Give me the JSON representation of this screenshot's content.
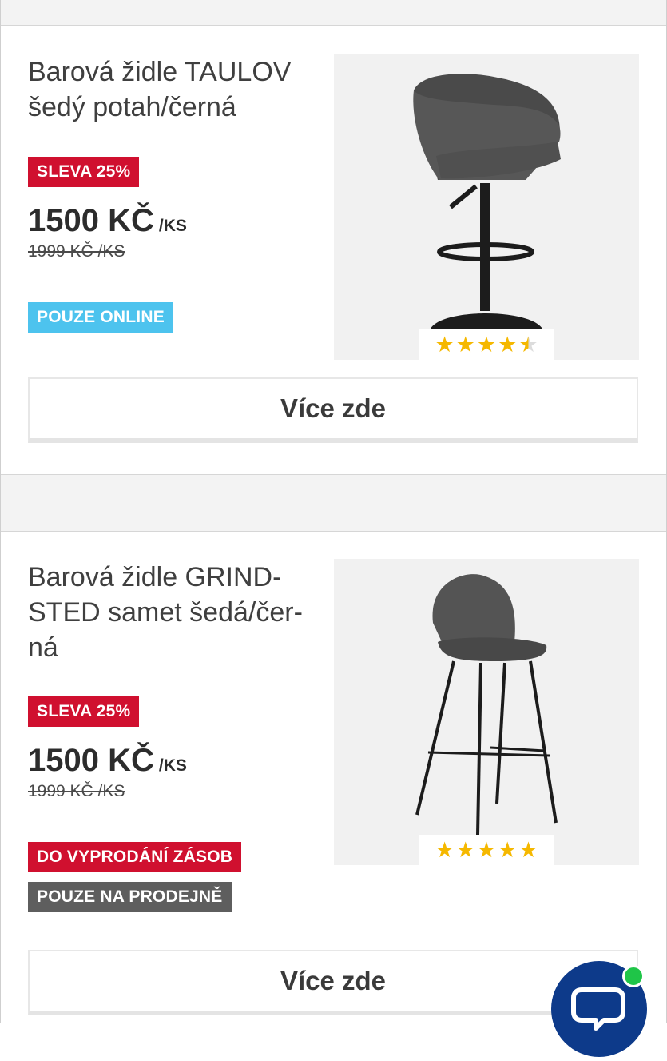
{
  "products": [
    {
      "title": "Barová židle TAULOV šedý potah/černá",
      "discount_badge": "SLEVA 25%",
      "price": "1500 KČ",
      "price_unit": "/KS",
      "old_price": "1999 KČ /KS",
      "tags": [
        "POUZE ONLINE"
      ],
      "rating": 4.5,
      "image": "bar-stool-taulov",
      "more_label": "Více zde"
    },
    {
      "title": "Barová židle GRIND-STED samet šedá/čer-ná",
      "title_lines": [
        "Barová židle GRIND-",
        "STED samet šedá/čer-",
        "ná"
      ],
      "discount_badge": "SLEVA 25%",
      "price": "1500 KČ",
      "price_unit": "/KS",
      "old_price": "1999 KČ /KS",
      "tags": [
        "DO VYPRODÁNÍ ZÁSOB",
        "POUZE NA PRODEJNĚ"
      ],
      "rating": 5,
      "image": "bar-stool-grindsted",
      "more_label": "Více zde"
    }
  ],
  "colors": {
    "sale_red": "#d0102f",
    "online_blue": "#4dc3ee",
    "store_grey": "#5e5e5e",
    "star_gold": "#f5b800",
    "chat_blue": "#0d3a8a",
    "online_green": "#1fc548"
  },
  "chat": {
    "icon": "chat-bubble-icon",
    "status": "online"
  }
}
